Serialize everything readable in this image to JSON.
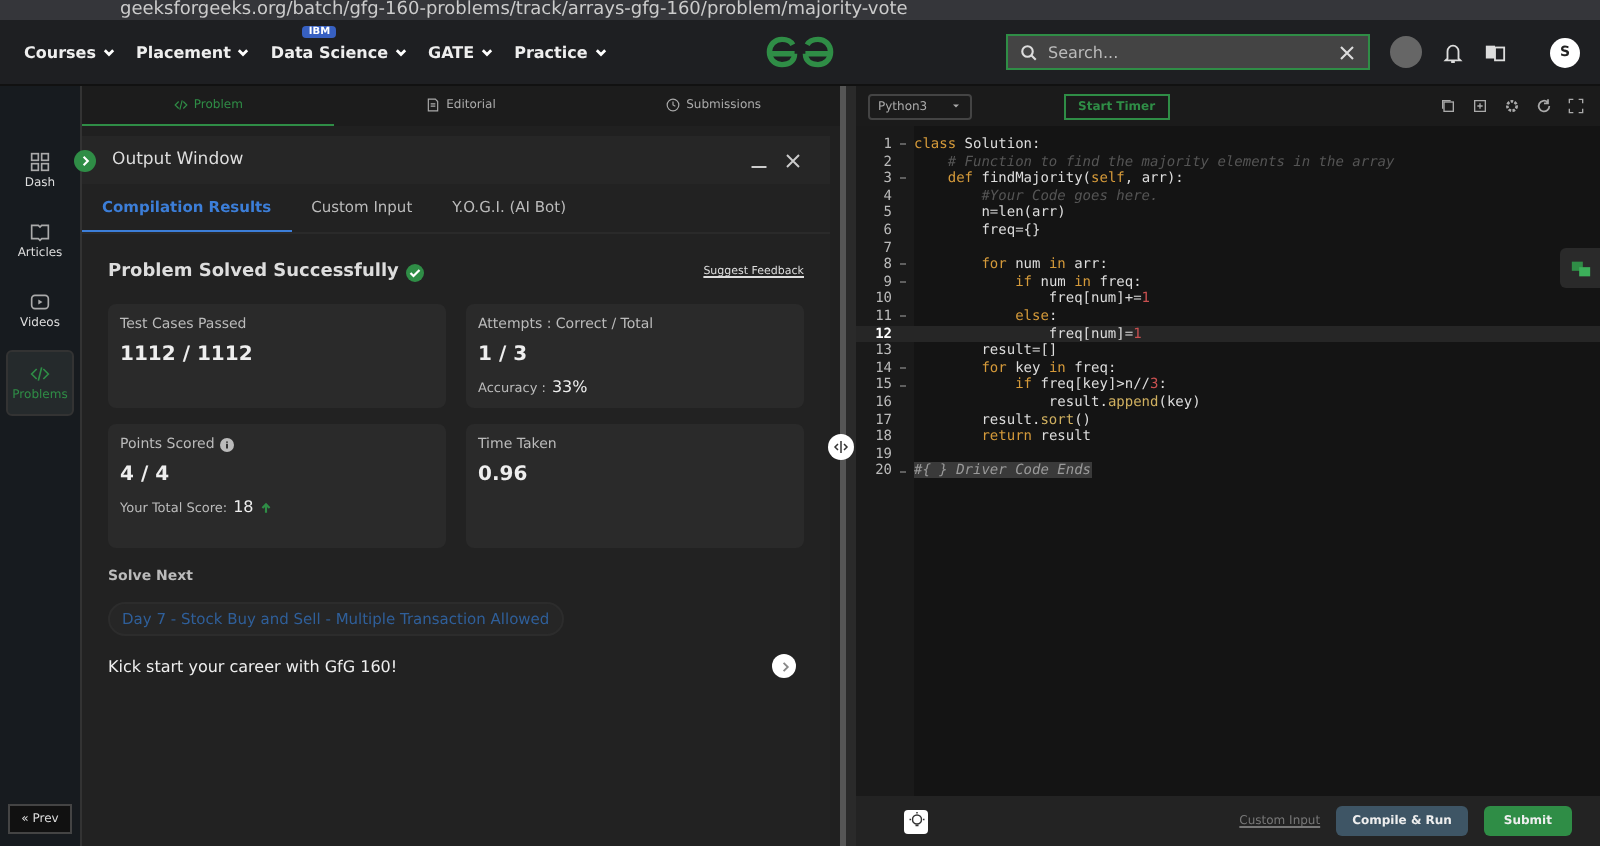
{
  "browser": {
    "url": "geeksforgeeks.org/batch/gfg-160-problems/track/arrays-gfg-160/problem/majority-vote"
  },
  "nav": {
    "items": [
      {
        "label": "Courses"
      },
      {
        "label": "Placement"
      },
      {
        "label": "Data Science",
        "badge": "IBM"
      },
      {
        "label": "GATE"
      },
      {
        "label": "Practice"
      }
    ],
    "search": {
      "placeholder": "Search..."
    },
    "avatar": "S"
  },
  "sidebar": {
    "items": [
      {
        "label": "Dash",
        "selected": false
      },
      {
        "label": "Articles",
        "selected": false
      },
      {
        "label": "Videos",
        "selected": false
      },
      {
        "label": "Problems",
        "selected": true
      }
    ],
    "prev": "« Prev"
  },
  "problem_tabs": [
    {
      "label": "Problem",
      "selected": true
    },
    {
      "label": "Editorial",
      "selected": false
    },
    {
      "label": "Submissions",
      "selected": false
    }
  ],
  "output": {
    "title": "Output Window",
    "tabs": [
      {
        "label": "Compilation Results",
        "selected": true
      },
      {
        "label": "Custom Input",
        "selected": false
      },
      {
        "label": "Y.O.G.I. (AI Bot)",
        "selected": false
      }
    ],
    "status": "Problem Solved Successfully",
    "feedback": "Suggest Feedback",
    "cards": [
      {
        "label": "Test Cases Passed",
        "value": "1112 / 1112",
        "info": false
      },
      {
        "label": "Attempts : Correct / Total",
        "value": "1 / 3",
        "sub_label": "Accuracy :",
        "sub_value": "33%",
        "info": false
      },
      {
        "label": "Points Scored",
        "value": "4 / 4",
        "sub_label": "Your Total Score:",
        "sub_value": "18",
        "info": true
      },
      {
        "label": "Time Taken",
        "value": "0.96",
        "info": false
      }
    ],
    "solve_next": {
      "heading": "Solve Next",
      "link": "Day 7 - Stock Buy and Sell - Multiple Transaction Allowed",
      "promo": "Kick start your career with GfG 160!"
    }
  },
  "editor": {
    "language": "Python3",
    "timer": "Start Timer",
    "lines": [
      {
        "n": "1",
        "fold": true,
        "current": false,
        "tokens": [
          {
            "kind": "kw",
            "text": "class"
          },
          {
            "kind": "p",
            "text": " Solution:"
          }
        ]
      },
      {
        "n": "2",
        "fold": false,
        "current": false,
        "tokens": [
          {
            "kind": "cm",
            "text": "    # Function to find the majority elements in the array"
          }
        ]
      },
      {
        "n": "3",
        "fold": true,
        "current": false,
        "tokens": [
          {
            "kind": "kw",
            "text": "    def"
          },
          {
            "kind": "p",
            "text": " findMajority("
          },
          {
            "kind": "kw",
            "text": "self"
          },
          {
            "kind": "p",
            "text": ", arr):"
          }
        ]
      },
      {
        "n": "4",
        "fold": false,
        "current": false,
        "tokens": [
          {
            "kind": "cm",
            "text": "        #Your Code goes here."
          }
        ]
      },
      {
        "n": "5",
        "fold": false,
        "current": false,
        "tokens": [
          {
            "kind": "p",
            "text": "        n=len(arr)"
          }
        ]
      },
      {
        "n": "6",
        "fold": false,
        "current": false,
        "tokens": [
          {
            "kind": "p",
            "text": "        freq={}"
          }
        ]
      },
      {
        "n": "7",
        "fold": false,
        "current": false
      },
      {
        "n": "8",
        "fold": true,
        "current": false,
        "tokens": [
          {
            "kind": "kw",
            "text": "        for"
          },
          {
            "kind": "p",
            "text": " num "
          },
          {
            "kind": "kw",
            "text": "in"
          },
          {
            "kind": "p",
            "text": " arr:"
          }
        ]
      },
      {
        "n": "9",
        "fold": true,
        "current": false,
        "tokens": [
          {
            "kind": "kw",
            "text": "            if"
          },
          {
            "kind": "p",
            "text": " num "
          },
          {
            "kind": "kw",
            "text": "in"
          },
          {
            "kind": "p",
            "text": " freq:"
          }
        ]
      },
      {
        "n": "10",
        "fold": false,
        "current": false,
        "tokens": [
          {
            "kind": "p",
            "text": "                freq[num]+="
          },
          {
            "kind": "num",
            "text": "1"
          }
        ]
      },
      {
        "n": "11",
        "fold": true,
        "current": false,
        "tokens": [
          {
            "kind": "kw",
            "text": "            else"
          },
          {
            "kind": "p",
            "text": ":"
          }
        ]
      },
      {
        "n": "12",
        "fold": false,
        "current": true,
        "tokens": [
          {
            "kind": "p",
            "text": "                freq[num]="
          },
          {
            "kind": "num",
            "text": "1"
          }
        ]
      },
      {
        "n": "13",
        "fold": false,
        "current": false,
        "tokens": [
          {
            "kind": "p",
            "text": "        result=[]"
          }
        ]
      },
      {
        "n": "14",
        "fold": true,
        "current": false,
        "tokens": [
          {
            "kind": "kw",
            "text": "        for"
          },
          {
            "kind": "p",
            "text": " key "
          },
          {
            "kind": "kw",
            "text": "in"
          },
          {
            "kind": "p",
            "text": " freq:"
          }
        ]
      },
      {
        "n": "15",
        "fold": true,
        "current": false,
        "tokens": [
          {
            "kind": "kw",
            "text": "            if"
          },
          {
            "kind": "p",
            "text": " freq[key]>n//"
          },
          {
            "kind": "num",
            "text": "3"
          },
          {
            "kind": "p",
            "text": ":"
          }
        ]
      },
      {
        "n": "16",
        "fold": false,
        "current": false,
        "tokens": [
          {
            "kind": "p",
            "text": "                result."
          },
          {
            "kind": "fn",
            "text": "append"
          },
          {
            "kind": "p",
            "text": "(key)"
          }
        ]
      },
      {
        "n": "17",
        "fold": false,
        "current": false,
        "tokens": [
          {
            "kind": "p",
            "text": "        result."
          },
          {
            "kind": "fn",
            "text": "sort"
          },
          {
            "kind": "p",
            "text": "()"
          }
        ]
      },
      {
        "n": "18",
        "fold": false,
        "current": false,
        "tokens": [
          {
            "kind": "kw",
            "text": "        return"
          },
          {
            "kind": "p",
            "text": " result"
          }
        ]
      },
      {
        "n": "19",
        "fold": false,
        "current": false
      },
      {
        "n": "20",
        "fold": true,
        "current": false,
        "tokens": [
          {
            "kind": "sel",
            "text": "#{ } Driver Code Ends"
          }
        ]
      }
    ],
    "custom_input": "Custom Input",
    "compile": "Compile & Run",
    "submit": "Submit"
  }
}
